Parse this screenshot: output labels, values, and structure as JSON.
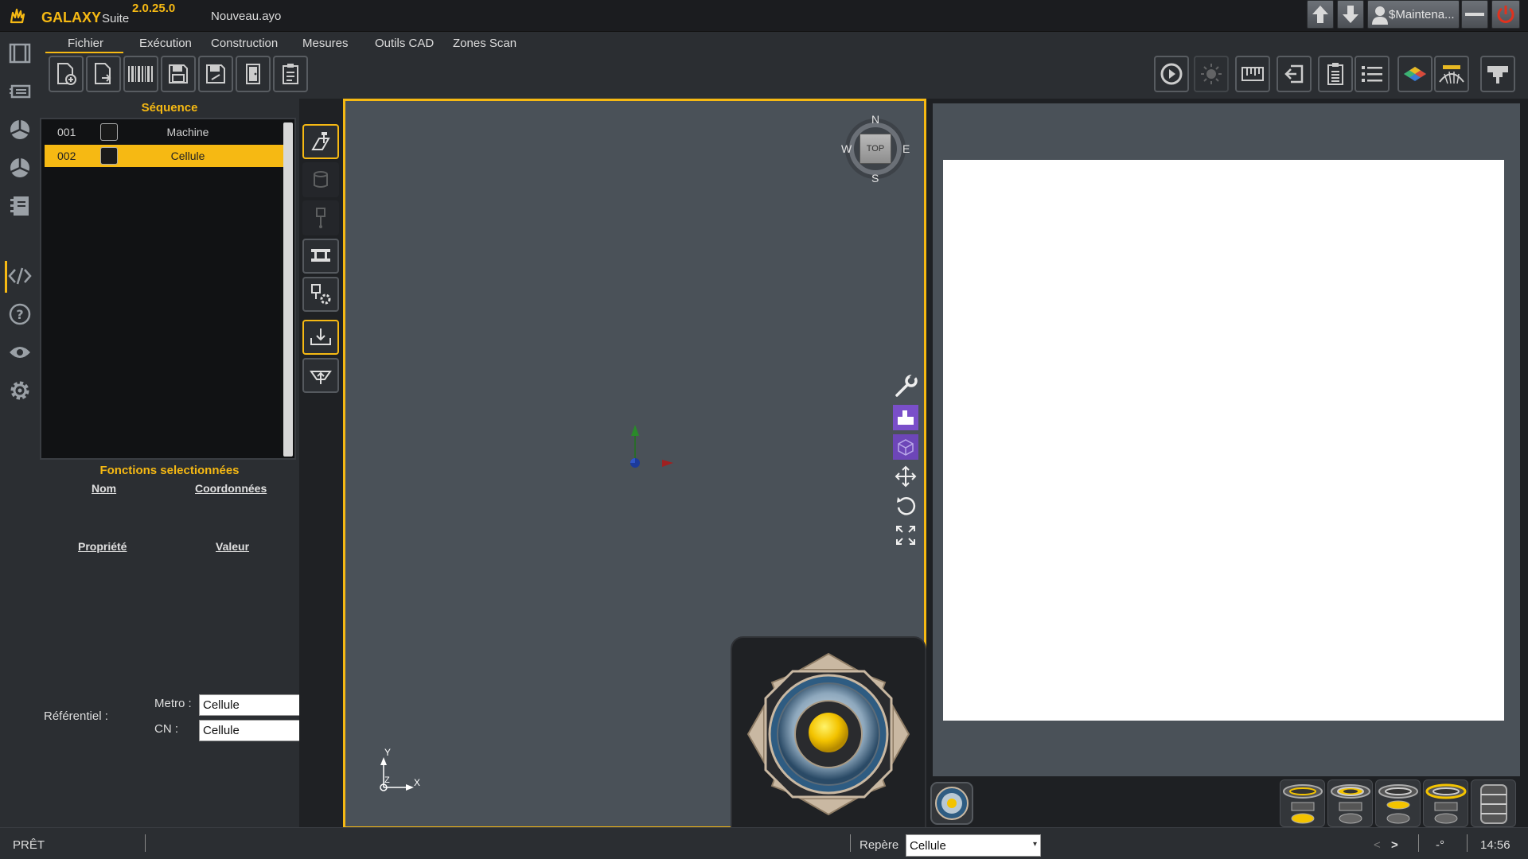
{
  "app": {
    "name": "GALAXY",
    "suite": "Suite",
    "version": "2.0.25.0",
    "file": "Nouveau.ayo"
  },
  "titlebar": {
    "user_label": "$Maintena..."
  },
  "rail": {
    "icons": [
      "frame-icon",
      "layers-icon",
      "pie-chart-icon",
      "pie-chart-alt-icon",
      "notebook-icon",
      "code-icon",
      "help-icon",
      "eye-icon",
      "gear-icon"
    ]
  },
  "menu": {
    "items": [
      "Fichier",
      "Exécution",
      "Construction",
      "Mesures",
      "Outils CAD",
      "Zones Scan"
    ]
  },
  "sequence": {
    "title": "Séquence",
    "rows": [
      {
        "num": "001",
        "label": "Machine"
      },
      {
        "num": "002",
        "label": "Cellule"
      }
    ]
  },
  "functions": {
    "title": "Fonctions selectionnées",
    "col_name": "Nom",
    "col_coords": "Coordonnées",
    "col_prop": "Propriété",
    "col_value": "Valeur",
    "referentiel_label": "Référentiel :",
    "metro_label": "Metro :",
    "metro_value": "Cellule",
    "cn_label": "CN :",
    "cn_value": "Cellule"
  },
  "viewport": {
    "compass": {
      "n": "N",
      "s": "S",
      "e": "E",
      "w": "W"
    },
    "viewcube_label": "TOP",
    "axis_y": "Y",
    "axis_x": "X",
    "axis_z": "Z"
  },
  "status": {
    "state": "PRÊT",
    "repere_label": "Repère",
    "repere_value": "Cellule",
    "nav_prev": "<",
    "nav_next": ">",
    "angle": "-°",
    "time": "14:56"
  },
  "colors": {
    "accent": "#f6b913",
    "background": "#1e2023",
    "panel": "#2b2e32",
    "viewport": "#4a5158"
  }
}
